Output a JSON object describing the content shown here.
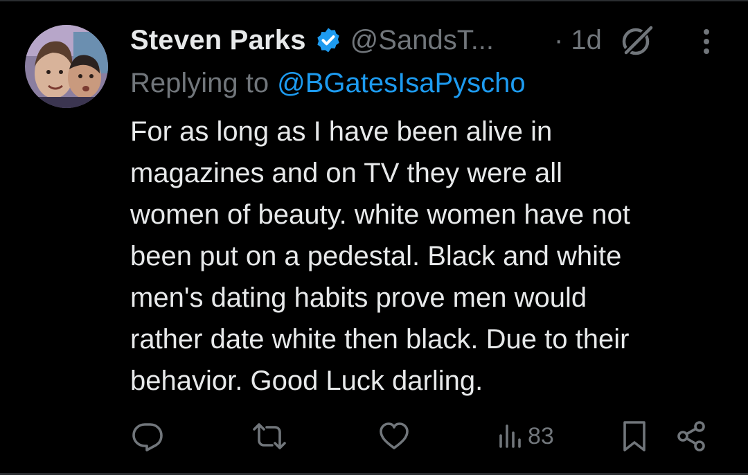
{
  "tweet": {
    "author_name": "Steven Parks",
    "handle": "@SandsT...",
    "time": "· 1d",
    "replying_label": "Replying to",
    "replying_to": "@BGatesIsaPyscho",
    "body_lines": [
      "For as long as I have been alive in",
      "magazines and on TV they were all",
      "women of beauty. white women have not",
      "been put on a pedestal. Black and white",
      "men's dating habits prove men would",
      "rather date white then black. Due to their",
      "behavior. Good Luck darling."
    ]
  },
  "actions": {
    "views_count": "83"
  },
  "icons": {
    "verified": "verified-badge-icon",
    "grok": "grok-icon",
    "more": "more-vertical-icon",
    "reply": "reply-icon",
    "retweet": "retweet-icon",
    "like": "heart-icon",
    "views": "views-bar-icon",
    "bookmark": "bookmark-icon",
    "share": "share-icon"
  },
  "colors": {
    "background": "#000000",
    "text": "#e7e9ea",
    "secondary": "#71767b",
    "accent": "#1d9bf0"
  }
}
